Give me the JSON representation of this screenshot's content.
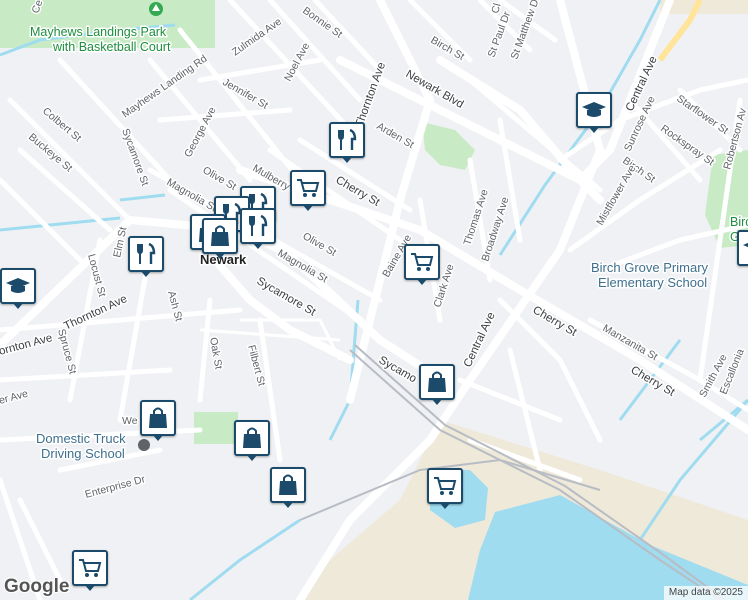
{
  "labels": {
    "mayhews_park": [
      "Mayhews Landings Park",
      "with Basketball Court"
    ],
    "town": "Newark",
    "domestic_truck": [
      "Domestic Truck",
      "Driving School"
    ],
    "birch_grove_school": [
      "Birch Grove Primary",
      "Elementary School"
    ],
    "birch_grove_park": [
      "Birch",
      "Grove"
    ],
    "streets": {
      "zulmida": "Zulmida Ave",
      "bonnie": "Bonnie St",
      "noel": "Noel Ave",
      "mayhews_rd": "Mayhews Landing Rd",
      "jennifer": "Jennifer St",
      "colbert": "Colbert St",
      "buckeye": "Buckeye St",
      "sycamore_w": "Sycamore St",
      "george": "George Ave",
      "olive_w": "Olive St",
      "magnolia_w": "Magnolia St",
      "mulberry": "Mulberry St",
      "olive_e": "Olive St",
      "magnolia_e": "Magnolia St",
      "thornton_n": "Thornton Ave",
      "newark_blvd": "Newark Blvd",
      "birch_n": "Birch St",
      "st_paul": "St Paul Dr",
      "st_matthew": "St Matthew Dr",
      "cherry_n": "Cherry St",
      "arden": "Arden St",
      "baine": "Baine Ave",
      "thomas": "Thomas Ave",
      "broadway": "Broadway Ave",
      "clark": "Clark Ave",
      "central_n": "Central Ave",
      "starflower": "Starflower St",
      "sunrose": "Sunrose Ave",
      "rockspray": "Rockspray St",
      "robertson": "Robertson Av",
      "birch_e": "Birch St",
      "mistflower": "Mistflower Ave",
      "cherry_e": "Cherry St",
      "cherry_se": "Cherry St",
      "manzanita": "Manzanita St",
      "escallonia": "Escallonia",
      "smith": "Smith Ave",
      "sycamore_mid": "Sycamore St",
      "sycamore_e": "Sycamo",
      "central_s": "Central Ave",
      "thornton_w": "Thornton Ave",
      "thornton_far": "ornton Ave",
      "elm": "Elm St",
      "locust": "Locust St",
      "ash": "Ash St",
      "spruce": "Spruce St",
      "oak": "Oak St",
      "filbert": "Filbert St",
      "enterprise": "Enterprise Dr",
      "we": "We",
      "er_ave": "er Ave",
      "ce": "Ce",
      "cl": "Cl"
    }
  },
  "pins": [
    {
      "id": "restaurant-mulberry",
      "icon": "restaurant"
    },
    {
      "id": "grocery-olive",
      "icon": "grocery"
    },
    {
      "id": "cluster-1",
      "icon": "restaurant"
    },
    {
      "id": "cluster-2",
      "icon": "restaurant"
    },
    {
      "id": "cluster-3",
      "icon": "shopping-bag"
    },
    {
      "id": "restaurant-elm",
      "icon": "restaurant"
    },
    {
      "id": "school-west",
      "icon": "school"
    },
    {
      "id": "grocery-baine",
      "icon": "grocery"
    },
    {
      "id": "school-arden",
      "icon": "school"
    },
    {
      "id": "school-east",
      "icon": "school"
    },
    {
      "id": "shop-sycamore",
      "icon": "shopping-bag"
    },
    {
      "id": "shop-enterprise-n",
      "icon": "shopping-bag"
    },
    {
      "id": "shop-filbert",
      "icon": "shopping-bag"
    },
    {
      "id": "shop-south",
      "icon": "shopping-bag"
    },
    {
      "id": "grocery-rail",
      "icon": "grocery"
    },
    {
      "id": "grocery-sw",
      "icon": "grocery"
    }
  ],
  "colors": {
    "land": "#f0f1f4",
    "road": "#ffffff",
    "water": "#9fdcf0",
    "park": "#c8ebc5",
    "sand": "#efe9d9",
    "pin_border": "#1b4a6b"
  },
  "attribution": "Map data ©2025",
  "logo": "Google"
}
